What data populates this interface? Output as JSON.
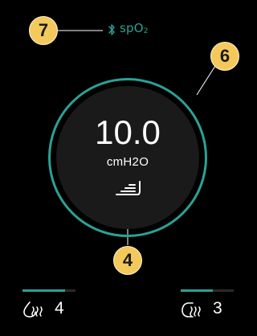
{
  "status_bar": {
    "bluetooth_icon": "bluetooth-icon",
    "spo2_label": "spO",
    "spo2_subscript": "2",
    "accent_color": "#2aa196"
  },
  "dial": {
    "pressure_value": "10.0",
    "pressure_unit": "cmH2O",
    "ramp_icon": "ramp-icon",
    "ring_color": "#2aa196"
  },
  "controls": {
    "humidifier": {
      "icon": "humidifier-icon",
      "level": "4",
      "fill_fraction": 0.8
    },
    "tube_heat": {
      "icon": "heated-tube-icon",
      "level": "3",
      "fill_fraction": 0.6
    }
  },
  "callouts": {
    "badge_7": "7",
    "badge_6": "6",
    "badge_4": "4",
    "badge_color": "#f4c95c"
  }
}
